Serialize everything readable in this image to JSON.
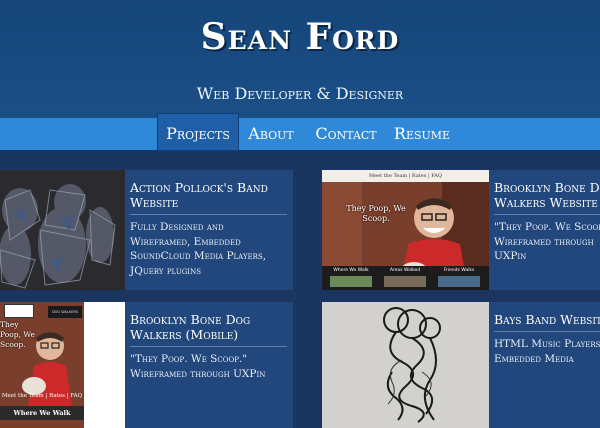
{
  "header": {
    "title": "Sean Ford",
    "subtitle": "Web Developer & Designer"
  },
  "nav": {
    "items": [
      {
        "label": "Projects",
        "active": true
      },
      {
        "label": "About"
      },
      {
        "label": "Contact"
      },
      {
        "label": "Resume"
      }
    ]
  },
  "projects": [
    {
      "title": "Action Pollock's Band Website",
      "description": "Fully Designed and Wireframed, Embedded SoundCloud Media Players, JQuery plugins"
    },
    {
      "title": "Brooklyn Bone Dog Walkers Website",
      "description": "\"They Poop. We Scoop.\" Wireframed through UXPin",
      "thumb": {
        "top_menu": "Meet the Team | Rates | FAQ",
        "tagline": "They Poop, We Scoop.",
        "buttons": [
          "Where We Walk",
          "Areas Walked",
          "Friends Walks"
        ]
      }
    },
    {
      "title": "Brooklyn Bone Dog Walkers (Mobile)",
      "description": "\"They Poop. We Scoop.\" Wireframed through UXPin",
      "thumb": {
        "logo_text": "DOG WALKERS",
        "tagline": "They Poop, We Scoop.",
        "menu": "Meet the Team | Rates | FAQ",
        "button": "Where We Walk"
      }
    },
    {
      "title": "Bays Band Website",
      "description": "HTML Music Players, Embedded Media"
    }
  ]
}
